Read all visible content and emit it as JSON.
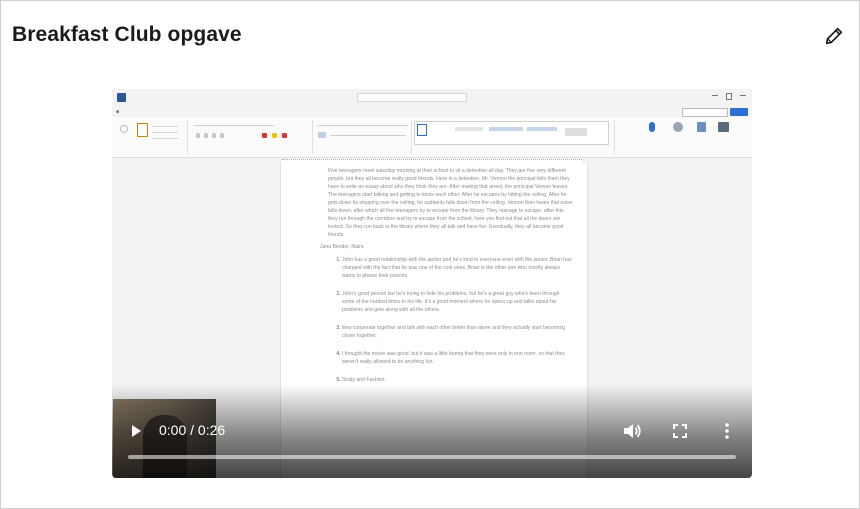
{
  "card": {
    "title": "Breakfast Club opgave"
  },
  "video": {
    "current_time": "0:00",
    "separator": " / ",
    "duration": "0:26",
    "progress_fraction": 0,
    "icons": [
      "play-icon",
      "volume-icon",
      "fullscreen-icon",
      "more-vert-icon",
      "pencil-icon"
    ]
  },
  "word": {
    "document_paragraph": "Five teenagers meet saturday morning at their school to sit a detention all day. They are five very different people, but they all become really good friends. Here in a detention, Mr. Vernon the principal tells them they have to write an essay about who they think they are. After making that arrest, the prinicipal Vernon leaves. The teenagers start talking and getting to know each other. After he escapes by hitting the ceiling. After he gets down by stepping over the ceiling, he suddenly falls down from the ceiling. Vernon then hears that noise falls down, after which all five teenagers try to escape from the library. They manage to escape, after this they run through the corridors and try to escape from the school, here you find out that all the doors are locked. So they run back to the library where they all talk and have fun. Eventually, they all become good friends.",
    "names_line": "Jana Bender, Naira",
    "answers": [
      "John has a good relationship with the janitor and he's kind to everyone even with the janitor. Brian has changed with the fact that he was one of the cool ones. Brian is the other one who mostly always wants to please their parents.",
      "John's good person but he's trying to hide his problems, but he's a great guy who's been through some of the hardest times in his life. It's a good moment where he opens up and talks about his problems and gets along with all the others.",
      "they cooperate together and talk with each other better than alone and they actually start becoming closer together.",
      "I thought the movie was good, but it was a little boring that they were only in one room, so that they weren't really allowed to do anything fun.",
      "Study and Fashion."
    ]
  }
}
